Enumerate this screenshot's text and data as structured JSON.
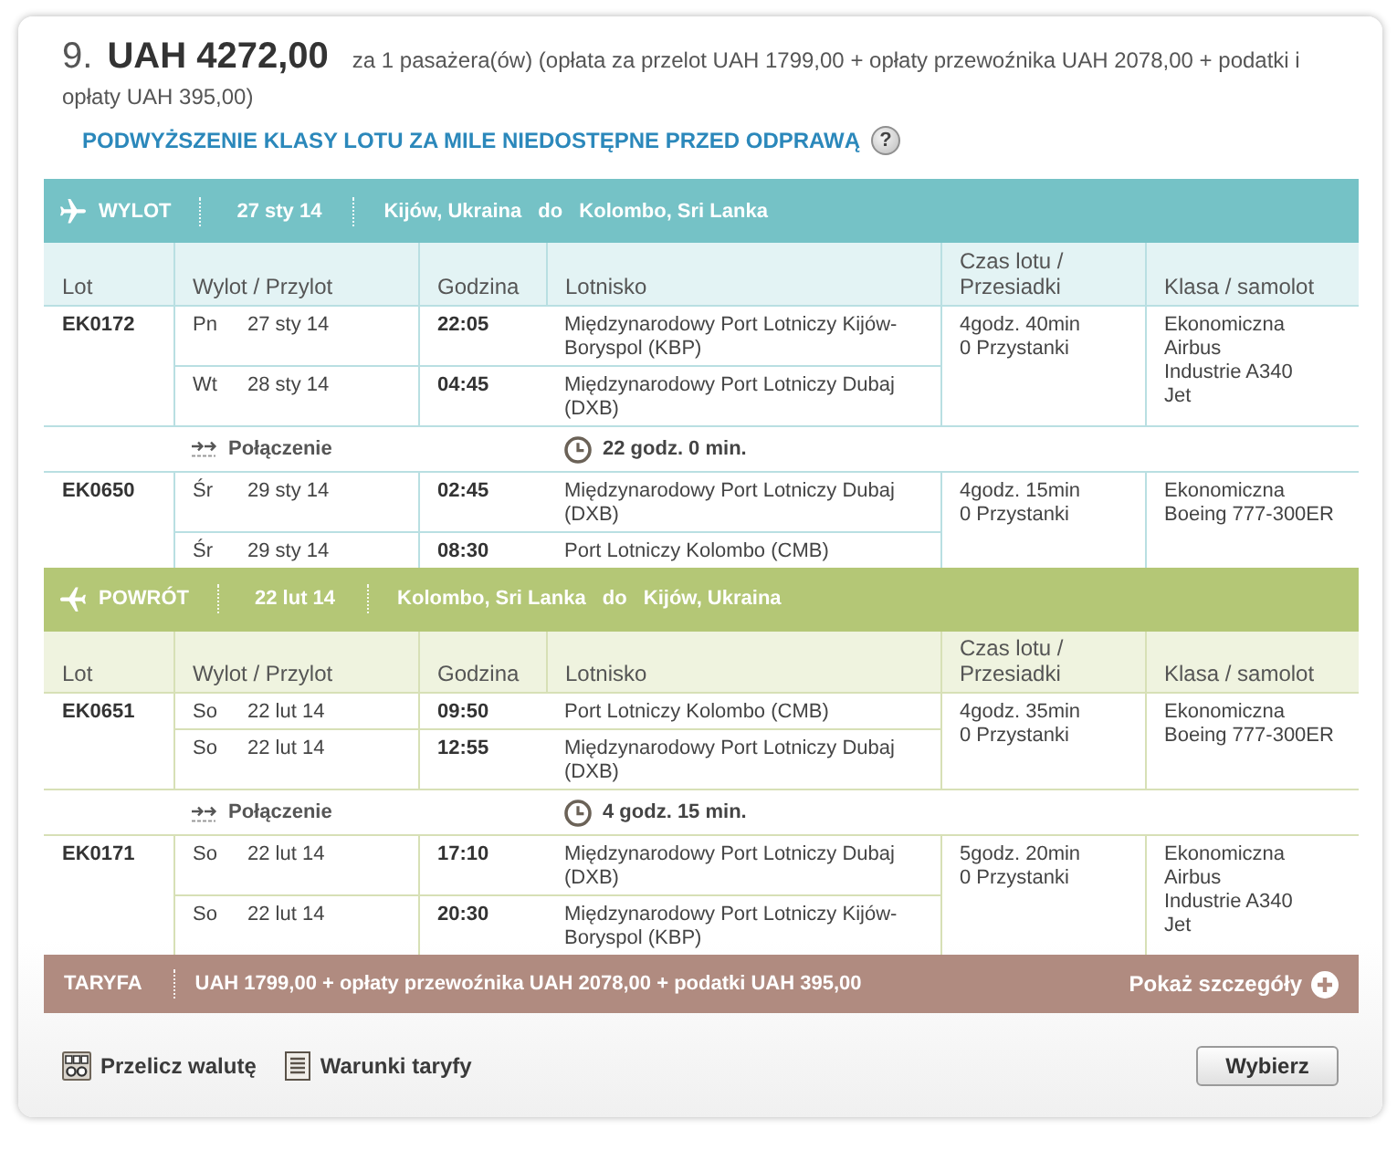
{
  "offer": {
    "index": "9.",
    "price": "UAH 4272,00",
    "price_note": "za 1 pasażera(ów) (opłata za przelot UAH 1799,00 + opłaty przewoźnika UAH 2078,00 + podatki i opłaty UAH 395,00)"
  },
  "upgrade_notice": {
    "text": "PODWYŻSZENIE KLASY LOTU ZA MILE NIEDOSTĘPNE PRZED ODPRAWĄ",
    "help_icon": "?"
  },
  "legs": [
    {
      "kind": "outbound",
      "label": "WYLOT",
      "date": "27 sty 14",
      "from": "Kijów, Ukraina",
      "connector": "do",
      "to": "Kolombo, Sri Lanka",
      "columns": [
        "Lot",
        "Wylot / Przylot",
        "Godzina",
        "Lotnisko",
        "Czas lotu / Przesiadki",
        "Klasa / samolot"
      ],
      "segments": [
        {
          "kind": "flight",
          "flight": "EK0172",
          "stops": [
            {
              "day": "Pn",
              "date": "27 sty 14",
              "time": "22:05",
              "airport": "Międzynarodowy Port Lotniczy Kijów-Boryspol (KBP)"
            },
            {
              "day": "Wt",
              "date": "28 sty 14",
              "time": "04:45",
              "airport": "Międzynarodowy Port Lotniczy Dubaj (DXB)"
            }
          ],
          "duration": "4godz. 40min",
          "stopovers": "0 Przystanki",
          "cabin": "Ekonomiczna",
          "aircraft": [
            "Airbus",
            "Industrie A340",
            "Jet"
          ]
        },
        {
          "kind": "connection",
          "label": "Połączenie",
          "duration": "22 godz. 0 min."
        },
        {
          "kind": "flight",
          "flight": "EK0650",
          "stops": [
            {
              "day": "Śr",
              "date": "29 sty 14",
              "time": "02:45",
              "airport": "Międzynarodowy Port Lotniczy Dubaj (DXB)"
            },
            {
              "day": "Śr",
              "date": "29 sty 14",
              "time": "08:30",
              "airport": "Port Lotniczy Kolombo (CMB)"
            }
          ],
          "duration": "4godz. 15min",
          "stopovers": "0 Przystanki",
          "cabin": "Ekonomiczna",
          "aircraft": [
            "Boeing 777-300ER"
          ]
        }
      ]
    },
    {
      "kind": "return",
      "label": "POWRÓT",
      "date": "22 lut 14",
      "from": "Kolombo, Sri Lanka",
      "connector": "do",
      "to": "Kijów, Ukraina",
      "columns": [
        "Lot",
        "Wylot / Przylot",
        "Godzina",
        "Lotnisko",
        "Czas lotu / Przesiadki",
        "Klasa / samolot"
      ],
      "segments": [
        {
          "kind": "flight",
          "flight": "EK0651",
          "stops": [
            {
              "day": "So",
              "date": "22 lut 14",
              "time": "09:50",
              "airport": "Port Lotniczy Kolombo (CMB)"
            },
            {
              "day": "So",
              "date": "22 lut 14",
              "time": "12:55",
              "airport": "Międzynarodowy Port Lotniczy Dubaj (DXB)"
            }
          ],
          "duration": "4godz. 35min",
          "stopovers": "0 Przystanki",
          "cabin": "Ekonomiczna",
          "aircraft": [
            "Boeing 777-300ER"
          ]
        },
        {
          "kind": "connection",
          "label": "Połączenie",
          "duration": "4 godz. 15 min."
        },
        {
          "kind": "flight",
          "flight": "EK0171",
          "stops": [
            {
              "day": "So",
              "date": "22 lut 14",
              "time": "17:10",
              "airport": "Międzynarodowy Port Lotniczy Dubaj (DXB)"
            },
            {
              "day": "So",
              "date": "22 lut 14",
              "time": "20:30",
              "airport": "Międzynarodowy Port Lotniczy Kijów-Boryspol (KBP)"
            }
          ],
          "duration": "5godz. 20min",
          "stopovers": "0 Przystanki",
          "cabin": "Ekonomiczna",
          "aircraft": [
            "Airbus",
            "Industrie A340",
            "Jet"
          ]
        }
      ]
    }
  ],
  "fare": {
    "label": "TARYFA",
    "text": "UAH 1799,00 + opłaty przewoźnika UAH 2078,00 + podatki UAH 395,00",
    "details_link": "Pokaż szczegóły"
  },
  "actions": {
    "links": [
      {
        "kind": "currency",
        "label": "Przelicz walutę"
      },
      {
        "kind": "rules",
        "label": "Warunki taryfy"
      }
    ],
    "button": "Wybierz"
  }
}
